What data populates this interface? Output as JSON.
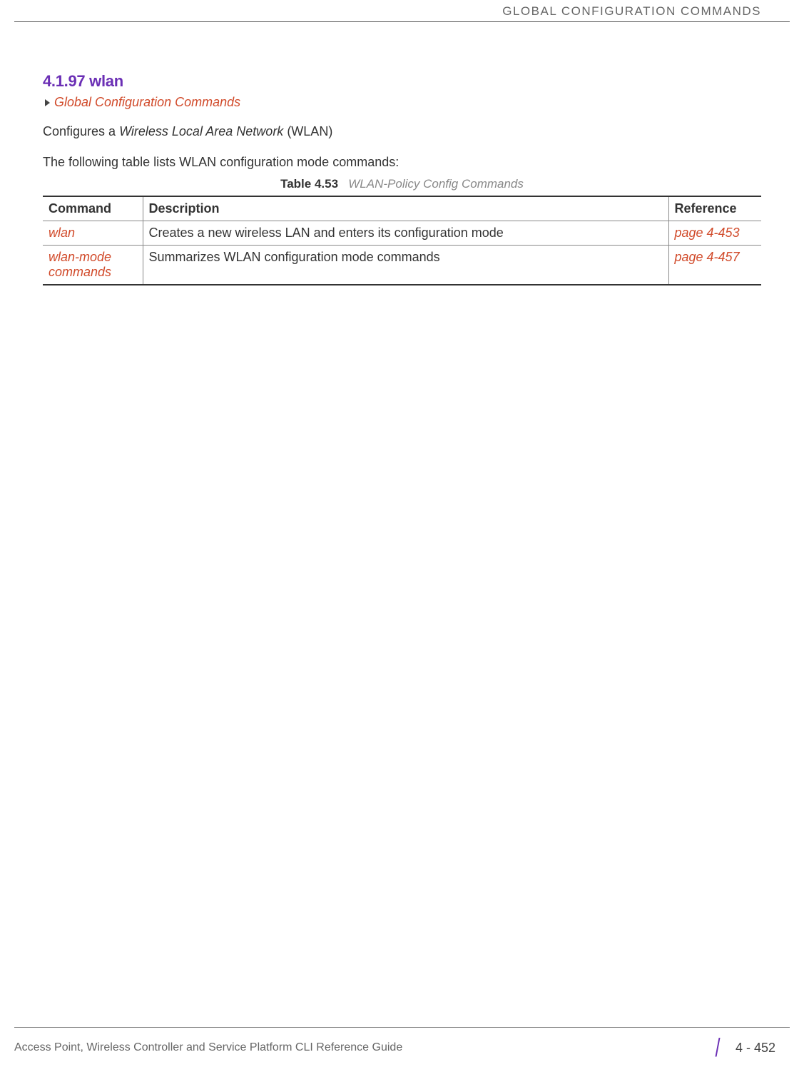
{
  "header": {
    "text": "GLOBAL CONFIGURATION COMMANDS"
  },
  "section": {
    "number_title": "4.1.97 wlan",
    "breadcrumb": "Global Configuration Commands",
    "intro_prefix": "Configures a ",
    "intro_italic": "Wireless Local Area Network",
    "intro_suffix": " (WLAN)",
    "sub_line": "The following table lists WLAN configuration mode commands:"
  },
  "table": {
    "caption_bold": "Table 4.53",
    "caption_italic": "WLAN-Policy Config Commands",
    "headers": {
      "command": "Command",
      "description": "Description",
      "reference": "Reference"
    },
    "rows": [
      {
        "command": "wlan",
        "description": "Creates a new wireless LAN and enters its configuration mode",
        "reference": "page 4-453"
      },
      {
        "command": "wlan-mode commands",
        "description": "Summarizes WLAN configuration mode commands",
        "reference": "page 4-457"
      }
    ]
  },
  "footer": {
    "left": "Access Point, Wireless Controller and Service Platform CLI Reference Guide",
    "page": "4 - 452"
  }
}
